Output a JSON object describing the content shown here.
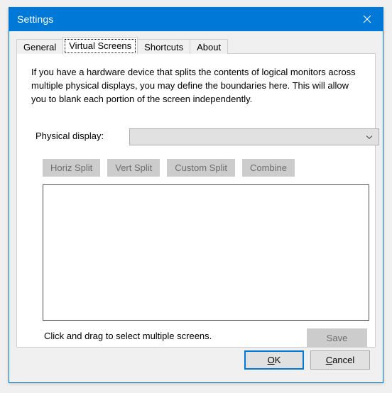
{
  "window": {
    "title": "Settings",
    "close_icon": "close-icon",
    "accent_color": "#0078d7",
    "titlebar_text_color": "#ffffff",
    "body_background": "#f0f0f0"
  },
  "tabs": [
    {
      "label": "General",
      "selected": false
    },
    {
      "label": "Virtual Screens",
      "selected": true
    },
    {
      "label": "Shortcuts",
      "selected": false
    },
    {
      "label": "About",
      "selected": false
    }
  ],
  "panel": {
    "description": "If you have a hardware device that splits the contents of logical monitors across multiple physical displays, you may define the boundaries here. This will allow you to blank each portion of the screen independently.",
    "physical_display": {
      "label": "Physical display:",
      "value": "",
      "placeholder": "",
      "dropdown_icon": "chevron-down-icon",
      "fill_color": "#e1e1e1"
    },
    "split_buttons": [
      {
        "label": "Horiz Split",
        "enabled": false
      },
      {
        "label": "Vert Split",
        "enabled": false
      },
      {
        "label": "Custom Split",
        "enabled": false
      },
      {
        "label": "Combine",
        "enabled": false
      }
    ],
    "canvas": {
      "name": "virtual-screens-canvas",
      "border_color": "#4d4d4d",
      "fill_color": "#ffffff"
    },
    "hint": "Click and drag to select multiple screens.",
    "save_button": {
      "label": "Save",
      "enabled": false
    }
  },
  "footer": {
    "ok": {
      "label": "OK",
      "mnemonic": "O",
      "default": true
    },
    "cancel": {
      "label": "Cancel",
      "mnemonic": "C",
      "default": false
    }
  }
}
